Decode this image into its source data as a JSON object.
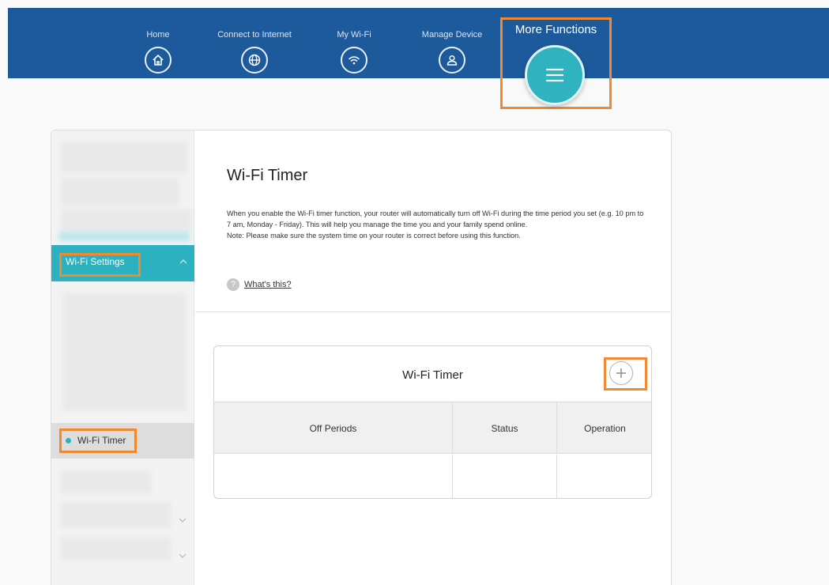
{
  "nav": {
    "items": [
      {
        "label": "Home",
        "icon": "home-icon"
      },
      {
        "label": "Connect to Internet",
        "icon": "globe-icon"
      },
      {
        "label": "My Wi-Fi",
        "icon": "wifi-icon"
      },
      {
        "label": "Manage Device",
        "icon": "user-icon"
      }
    ],
    "more_label": "More Functions",
    "more_icon": "menu-icon"
  },
  "sidebar": {
    "section_label": "Wi-Fi Settings",
    "active_item": "Wi-Fi Timer"
  },
  "main": {
    "title": "Wi-Fi Timer",
    "description": "When you enable the Wi-Fi timer function, your router will automatically turn off Wi-Fi during the time period you set (e.g. 10 pm to 7 am, Monday - Friday). This will help you manage the time you and your family spend online.",
    "note": "Note: Please make sure the system time on your router is correct before using this function.",
    "help_link": "What's this?"
  },
  "timer_card": {
    "title": "Wi-Fi Timer",
    "add_icon": "plus-icon",
    "columns": [
      "Off Periods",
      "Status",
      "Operation"
    ]
  },
  "colors": {
    "nav_bg": "#1d5a9c",
    "accent": "#2cb1c0",
    "highlight": "#f08a32"
  }
}
